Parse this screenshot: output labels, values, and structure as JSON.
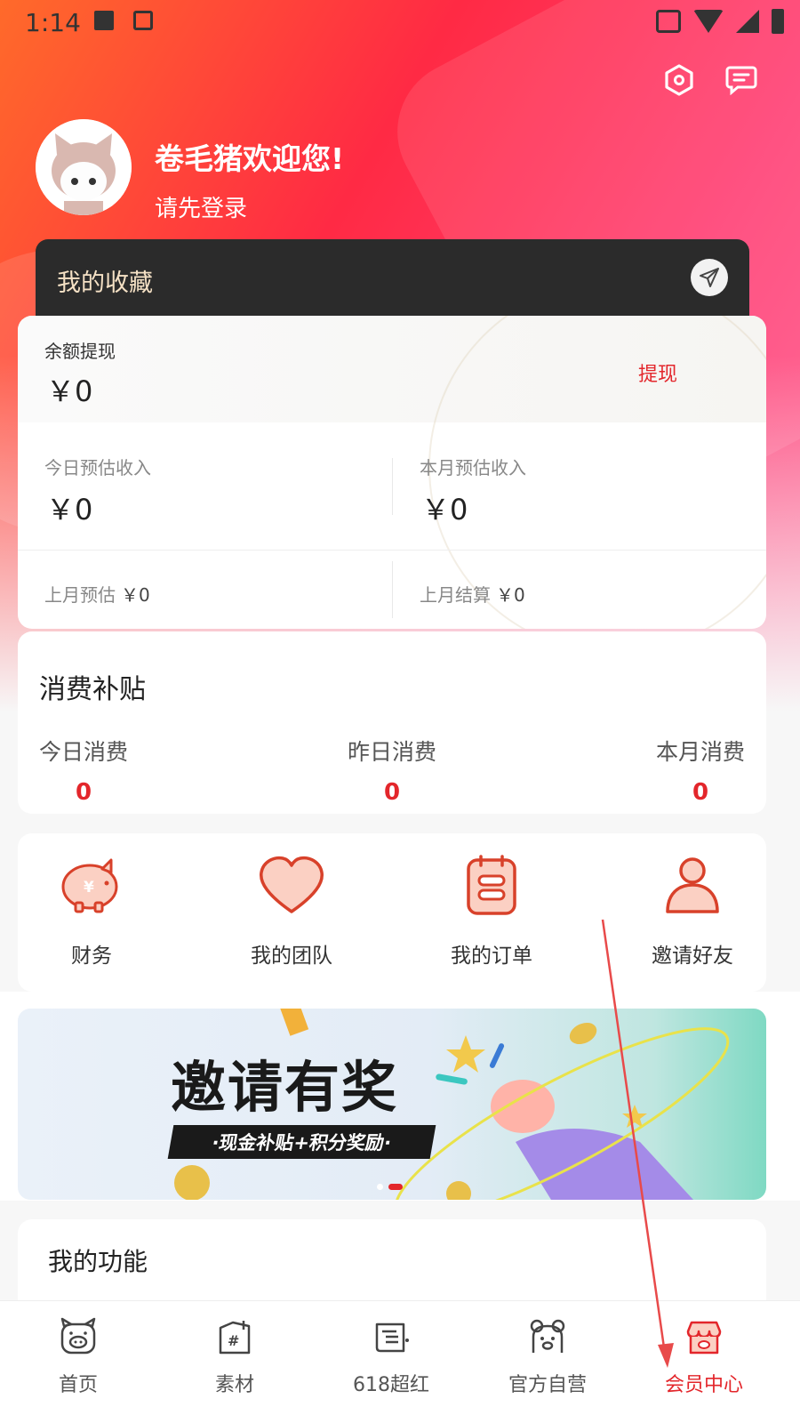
{
  "status_bar": {
    "time": "1:14"
  },
  "header": {
    "welcome": "卷毛猪欢迎您!",
    "login_prompt": "请先登录",
    "icons": [
      "settings-hex-icon",
      "message-icon"
    ]
  },
  "favorites": {
    "label": "我的收藏"
  },
  "balance": {
    "label": "余额提现",
    "value": "￥0",
    "withdraw": "提现",
    "today_label": "今日预估收入",
    "today_value": "￥0",
    "month_label": "本月预估收入",
    "month_value": "￥0",
    "last_month_est_label": "上月预估",
    "last_month_est_value": "￥0",
    "last_month_settle_label": "上月结算",
    "last_month_settle_value": "￥0"
  },
  "subsidy": {
    "title": "消费补贴",
    "items": [
      {
        "label": "今日消费",
        "value": "0"
      },
      {
        "label": "昨日消费",
        "value": "0"
      },
      {
        "label": "本月消费",
        "value": "0"
      }
    ]
  },
  "quick_actions": [
    {
      "label": "财务",
      "icon": "piggy-bank-icon"
    },
    {
      "label": "我的团队",
      "icon": "heart-icon"
    },
    {
      "label": "我的订单",
      "icon": "calendar-icon"
    },
    {
      "label": "邀请好友",
      "icon": "person-icon"
    }
  ],
  "banner": {
    "title": "邀请有奖",
    "subtitle": "·现金补贴+积分奖励·"
  },
  "my_functions": {
    "title": "我的功能"
  },
  "tabbar": [
    {
      "label": "首页",
      "icon": "pig-face-icon"
    },
    {
      "label": "素材",
      "icon": "material-icon"
    },
    {
      "label": "618超红",
      "icon": "calendar-note-icon"
    },
    {
      "label": "官方自营",
      "icon": "bear-icon"
    },
    {
      "label": "会员中心",
      "icon": "shop-icon",
      "active": true
    }
  ],
  "colors": {
    "accent": "#e3262b",
    "gold_text": "#f5e1c5",
    "dark_card": "#2b2b2b"
  }
}
